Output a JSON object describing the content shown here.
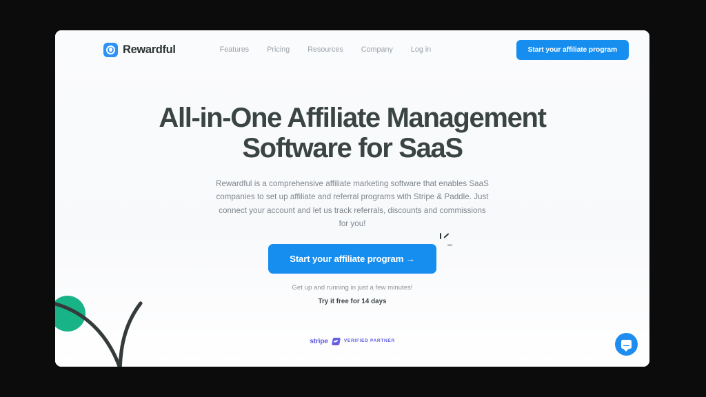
{
  "window": {
    "background_color": "#0c0c0c",
    "page_background": "#fafbfc"
  },
  "header": {
    "brand": {
      "name": "Rewardful",
      "logo_icon": "bullseye-target-icon"
    },
    "nav_items": [
      {
        "label": "Features"
      },
      {
        "label": "Pricing"
      },
      {
        "label": "Resources"
      },
      {
        "label": "Company"
      },
      {
        "label": "Log in"
      }
    ],
    "cta_label": "Start your affiliate program"
  },
  "hero": {
    "title_line1": "All-in-One Affiliate Management",
    "title_line2": "Software for SaaS",
    "subtitle": "Rewardful is a comprehensive affiliate marketing software that enables SaaS companies to set up affiliate and referral programs with Stripe & Paddle. Just connect your account and let us track referrals, discounts and commissions for you!",
    "cta_label": "Start your affiliate program →",
    "cta_note": "Get up and running in just a few minutes!",
    "cta_trial": "Try it free for 14 days"
  },
  "badge": {
    "stripe_word": "stripe",
    "partner_text": "VERIFIED PARTNER",
    "icon": "stripe-verified-badge-icon",
    "color": "#6460e0"
  },
  "chat": {
    "icon": "chat-bubble-icon",
    "color": "#1f8df0"
  },
  "decoration": {
    "circle_color": "#19b388",
    "stroke_color": "#343b3a"
  },
  "colors": {
    "accent_blue": "#168ef0",
    "heading": "#3a4442",
    "body_text": "#7d858c",
    "nav_text": "#9aa1a8"
  }
}
